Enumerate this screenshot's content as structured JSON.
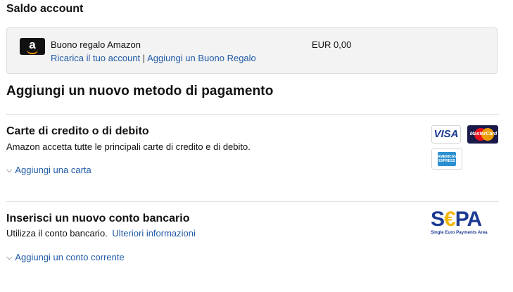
{
  "balance": {
    "heading": "Saldo account",
    "gift_card_label": "Buono regalo Amazon",
    "amount": "EUR 0,00",
    "reload_link": "Ricarica il tuo account",
    "separator": "|",
    "add_gift_link": "Aggiungi un Buono Regalo",
    "logo_letter": "a"
  },
  "add_method": {
    "heading": "Aggiungi un nuovo metodo di pagamento"
  },
  "cards_section": {
    "heading": "Carte di credito o di debito",
    "description": "Amazon accetta tutte le principali carte di credito e di debito.",
    "add_link": "Aggiungi una carta",
    "brands": {
      "visa": "VISA",
      "mastercard": "MasterCard",
      "amex": "AMERICAN EXPRESS"
    }
  },
  "bank_section": {
    "heading": "Inserisci un nuovo conto bancario",
    "description": "Utilizza il conto bancario.",
    "more_info_link": "Ulteriori informazioni",
    "add_link": "Aggiungi un conto corrente",
    "sepa_logo_left": "S",
    "sepa_logo_euro": "€",
    "sepa_logo_right": "PA",
    "sepa_tagline": "Single Euro Payments Area"
  },
  "colors": {
    "link": "#1f5aa6",
    "sepa_blue": "#1d3b93",
    "sepa_yellow": "#f2b705"
  },
  "icons": [
    "chevron-down-icon",
    "amazon-logo-icon",
    "visa-icon",
    "mastercard-icon",
    "amex-icon",
    "sepa-logo-icon"
  ]
}
